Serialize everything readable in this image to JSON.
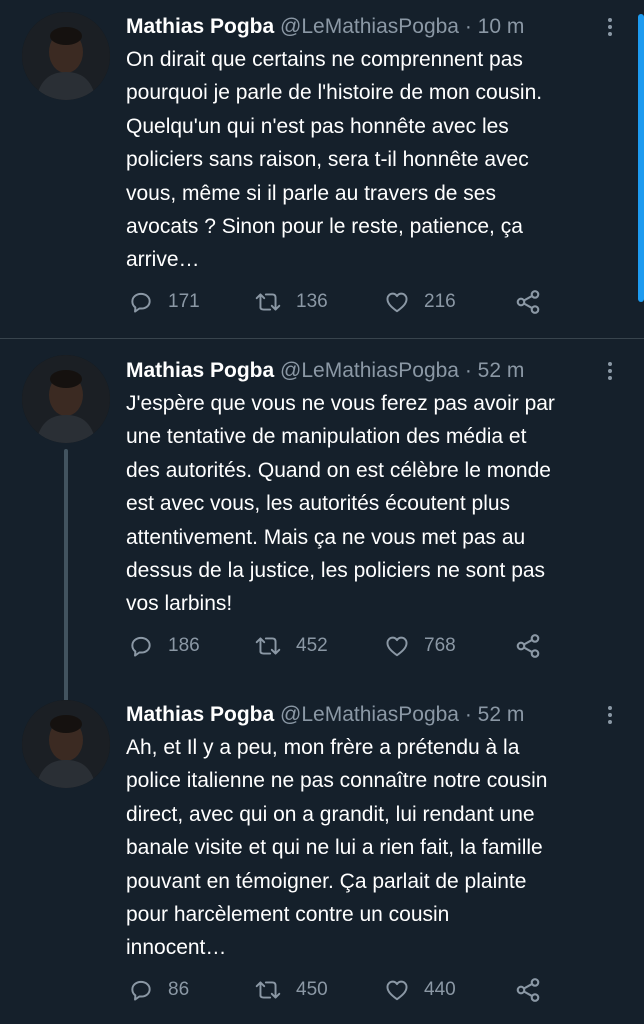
{
  "tweets": [
    {
      "name": "Mathias Pogba",
      "handle": "@LeMathiasPogba",
      "time": "· 10 m",
      "text": "On dirait que certains ne comprennent pas\npourquoi je parle de l'histoire de mon cousin.\nQuelqu'un qui n'est pas honnête avec les\npoliciers sans raison, sera t-il honnête avec\nvous, même si il parle au travers de ses\navocats ? Sinon pour le reste, patience, ça\narrive…",
      "replies": "171",
      "retweets": "136",
      "likes": "216"
    },
    {
      "name": "Mathias Pogba",
      "handle": "@LeMathiasPogba",
      "time": "· 52 m",
      "text": "J'espère que vous ne vous ferez pas avoir par\nune tentative de manipulation des média et\ndes autorités. Quand on est célèbre le monde\nest avec vous, les autorités écoutent plus\nattentivement. Mais ça ne vous met pas au\ndessus de la justice, les policiers ne sont pas\nvos larbins!",
      "replies": "186",
      "retweets": "452",
      "likes": "768"
    },
    {
      "name": "Mathias Pogba",
      "handle": "@LeMathiasPogba",
      "time": "· 52 m",
      "text": "Ah, et Il y a peu, mon frère a prétendu à la\npolice italienne ne pas connaître notre cousin\ndirect, avec qui on a grandit, lui rendant une\nbanale visite et qui ne lui a rien fait, la famille\npouvant en témoigner. Ça parlait de plainte\npour harcèlement contre un cousin\ninnocent…",
      "replies": "86",
      "retweets": "450",
      "likes": "440"
    }
  ],
  "icons": {
    "reply": "reply-icon",
    "retweet": "retweet-icon",
    "like": "heart-icon",
    "share": "share-icon",
    "more": "more-icon"
  },
  "colors": {
    "background": "#15202b",
    "secondary_text": "#8b98a5",
    "divider": "#38444d",
    "scrollbar": "#1d9bf0"
  }
}
